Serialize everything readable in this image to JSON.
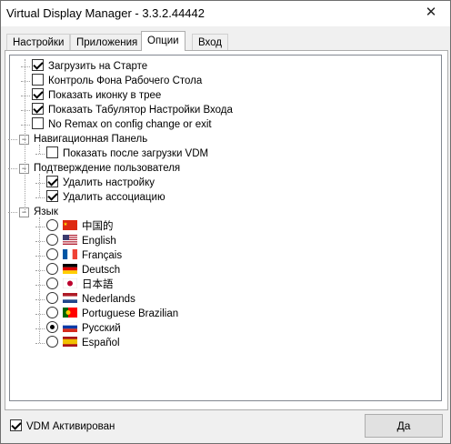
{
  "window": {
    "title": "Virtual Display Manager - 3.3.2.44442",
    "close_symbol": "✕"
  },
  "tabs": [
    "Настройки",
    "Приложения",
    "Опции",
    "Вход"
  ],
  "tree": {
    "items": [
      {
        "label": "Загрузить на Старте",
        "checked": true
      },
      {
        "label": "Контроль Фона Рабочего Стола",
        "checked": false
      },
      {
        "label": "Показать иконку в трее",
        "checked": true
      },
      {
        "label": "Показать Табулятор Настройки Входа",
        "checked": true
      },
      {
        "label": "No Remax on config change or exit",
        "checked": false
      }
    ],
    "nav_group": {
      "label": "Навигационная Панель",
      "items": [
        {
          "label": "Показать после загрузки VDM",
          "checked": false
        }
      ]
    },
    "confirm_group": {
      "label": "Подтверждение пользователя",
      "items": [
        {
          "label": "Удалить настройку",
          "checked": true
        },
        {
          "label": "Удалить ассоциацию",
          "checked": true
        }
      ]
    },
    "lang_group": {
      "label": "Язык",
      "items": [
        {
          "label": "中国的",
          "flag": "cn-flag",
          "selected": false
        },
        {
          "label": "English",
          "flag": "us-flag",
          "selected": false
        },
        {
          "label": "Français",
          "flag": "fr-flag",
          "selected": false
        },
        {
          "label": "Deutsch",
          "flag": "de-flag",
          "selected": false
        },
        {
          "label": "日本語",
          "flag": "jp-flag",
          "selected": false
        },
        {
          "label": "Nederlands",
          "flag": "nl-flag",
          "selected": false
        },
        {
          "label": "Portuguese Brazilian",
          "flag": "br-flag",
          "selected": false
        },
        {
          "label": "Русский",
          "flag": "ru-flag",
          "selected": true
        },
        {
          "label": "Español",
          "flag": "es-flag",
          "selected": false
        }
      ]
    }
  },
  "footer": {
    "activated_label": "VDM Активирован",
    "activated_checked": true,
    "ok_label": "Да"
  }
}
